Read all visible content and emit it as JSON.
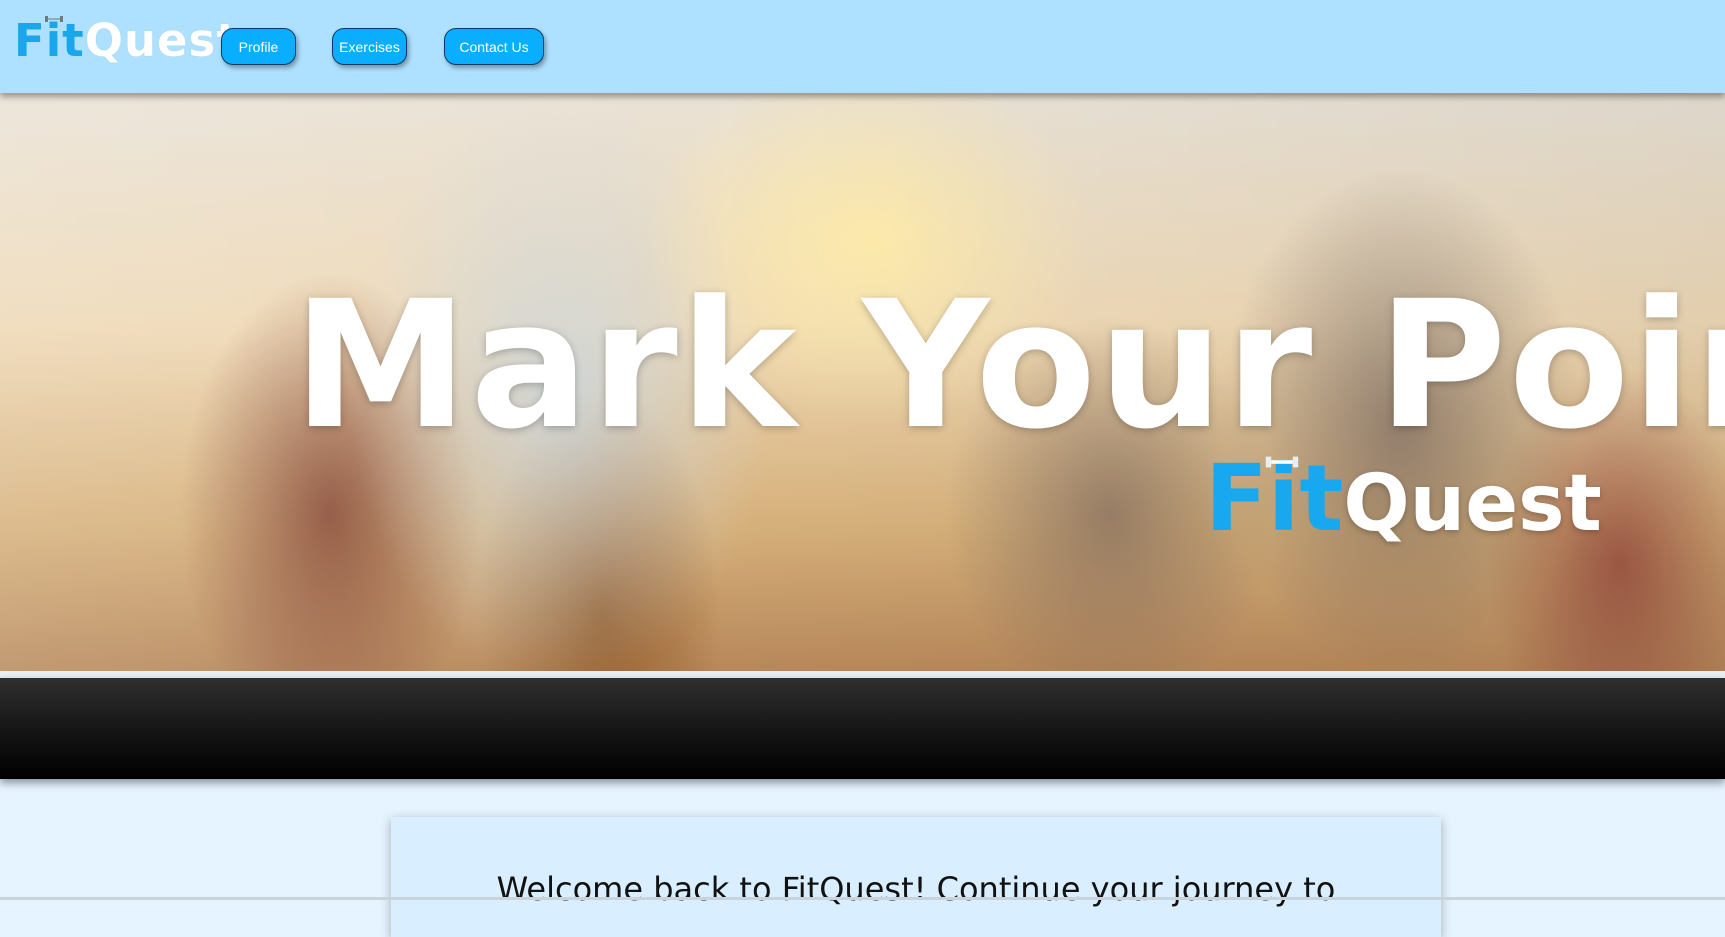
{
  "brand": {
    "fit": "Fit",
    "quest": "Quest"
  },
  "nav": {
    "items": [
      {
        "label": "Profile"
      },
      {
        "label": "Exercises"
      },
      {
        "label": "Contact Us"
      }
    ]
  },
  "hero": {
    "title": "Mark Your Point!",
    "logo_fit": "Fit",
    "logo_quest": "Quest"
  },
  "welcome": {
    "text": "Welcome back to FitQuest! Continue your journey to"
  },
  "colors": {
    "header_bg": "#aee1ff",
    "accent": "#0aaeff",
    "brand_blue": "#17a8f0",
    "page_bg": "#e6f4ff",
    "card_bg": "#d9efff"
  },
  "icons": [
    "dumbbell-icon"
  ]
}
